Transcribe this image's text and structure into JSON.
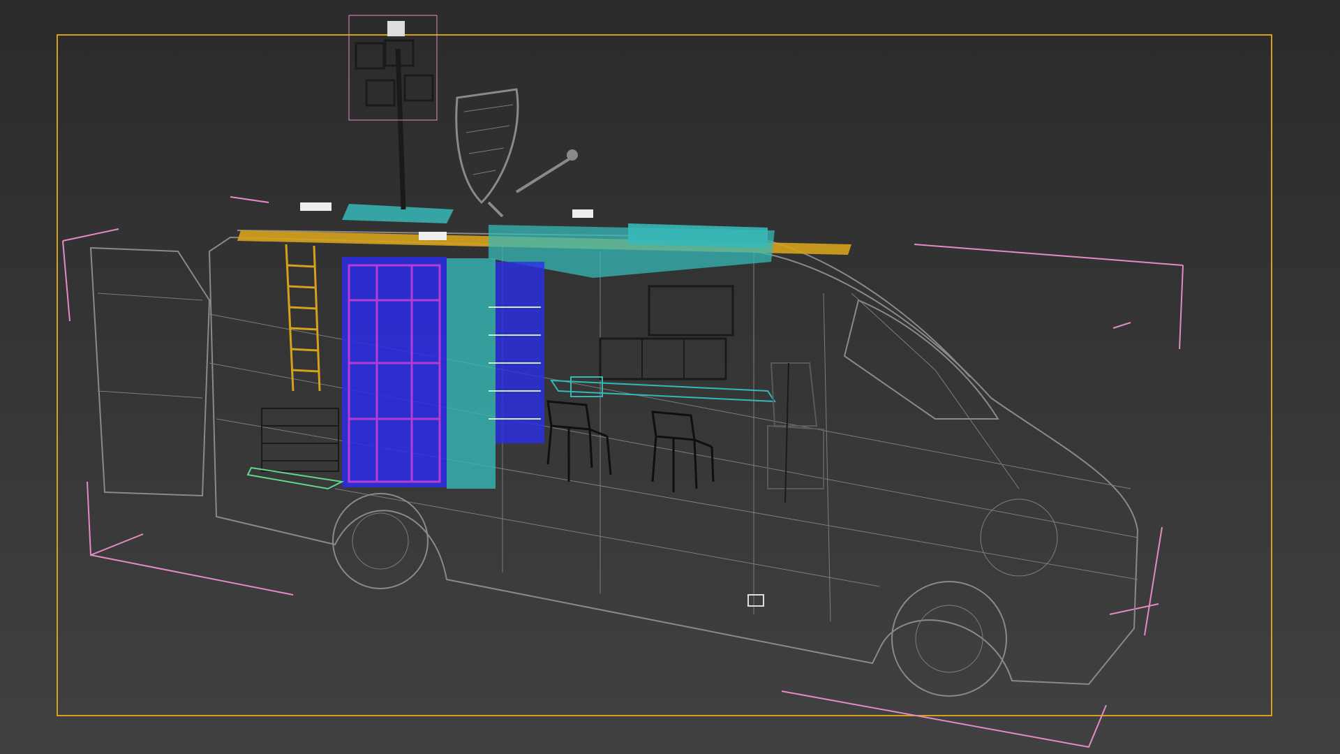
{
  "viewport": {
    "background_color": "#2f2f2f",
    "safe_frame_color": "#d6a21c",
    "bounding_box_color": "#e58ac4",
    "wireframe_color": "#8a8a8a"
  },
  "scene": {
    "object": "broadcast-van-wireframe",
    "rack_colors": [
      "#2a2ee8",
      "#b83bd8",
      "#37b8b8",
      "#d6a21c"
    ]
  }
}
